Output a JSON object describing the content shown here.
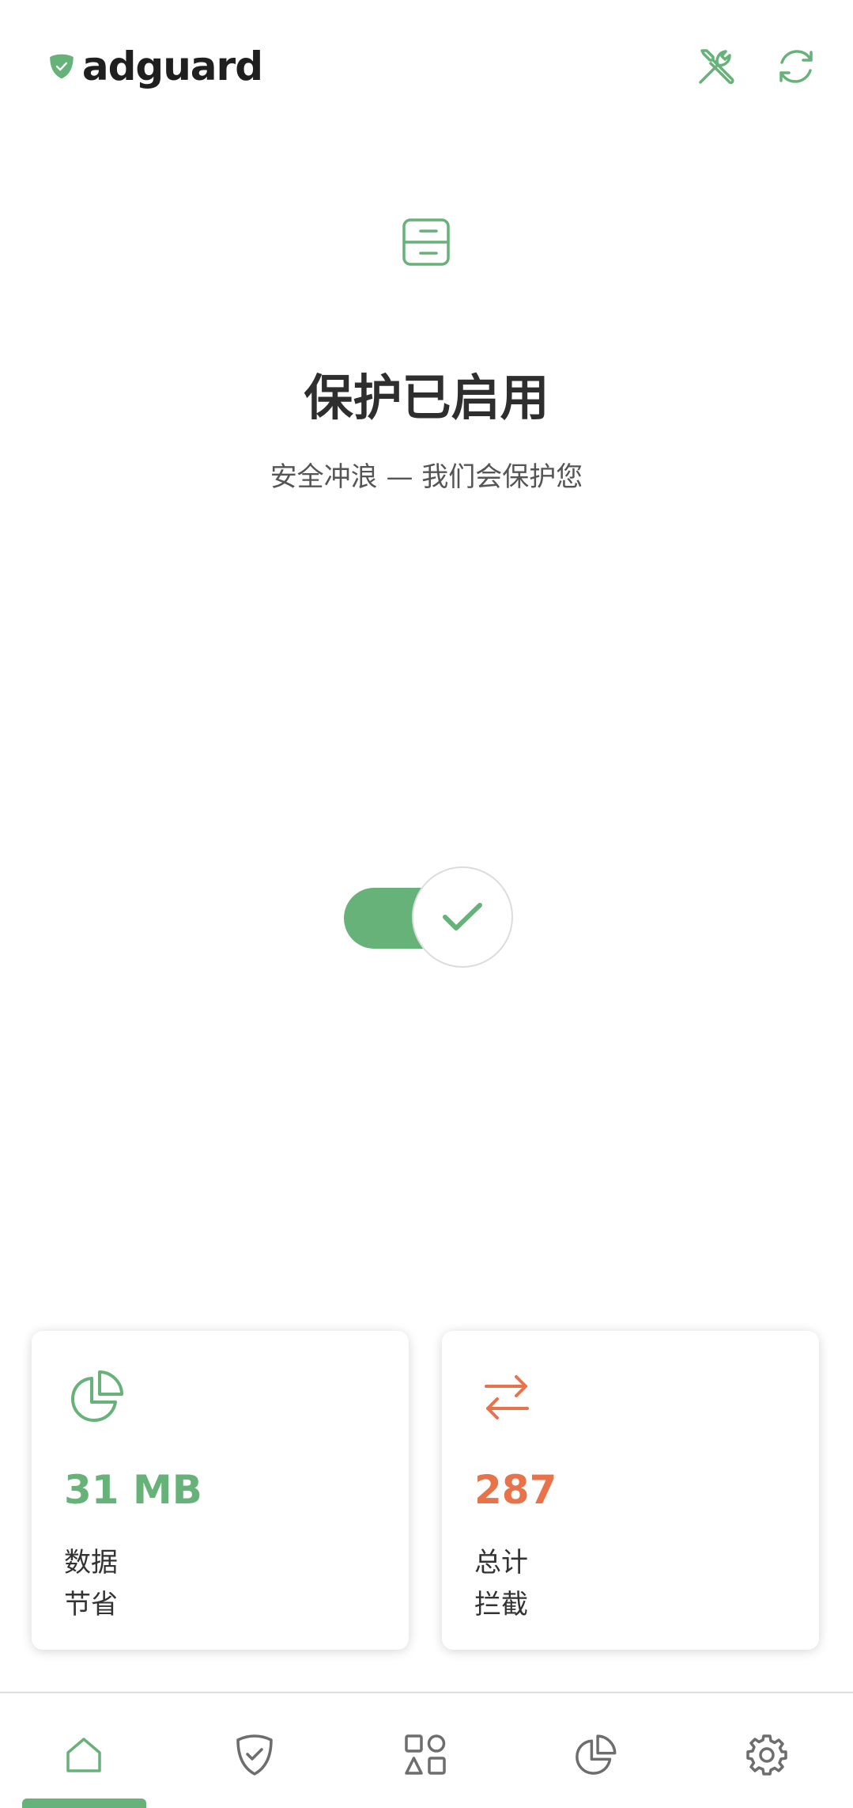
{
  "header": {
    "brand_name": "adguard",
    "tools_icon": "tools-icon",
    "refresh_icon": "refresh-icon"
  },
  "status": {
    "icon": "dns-server-icon",
    "title": "保护已启用",
    "subtitle": "安全冲浪 — 我们会保护您",
    "protection_enabled": true
  },
  "stats": [
    {
      "icon": "pie-chart-icon",
      "value": "31 MB",
      "label_line1": "数据",
      "label_line2": "节省",
      "color": "#67b279"
    },
    {
      "icon": "transfer-arrows-icon",
      "value": "287",
      "label_line1": "总计",
      "label_line2": "拦截",
      "color": "#e8734a"
    }
  ],
  "bottom_nav": {
    "items": [
      "home-icon",
      "shield-check-icon",
      "apps-icon",
      "statistics-icon",
      "settings-icon"
    ],
    "active_index": 0
  },
  "colors": {
    "accent_green": "#67b279",
    "accent_orange": "#e8734a",
    "nav_inactive": "#6d6d6d"
  }
}
